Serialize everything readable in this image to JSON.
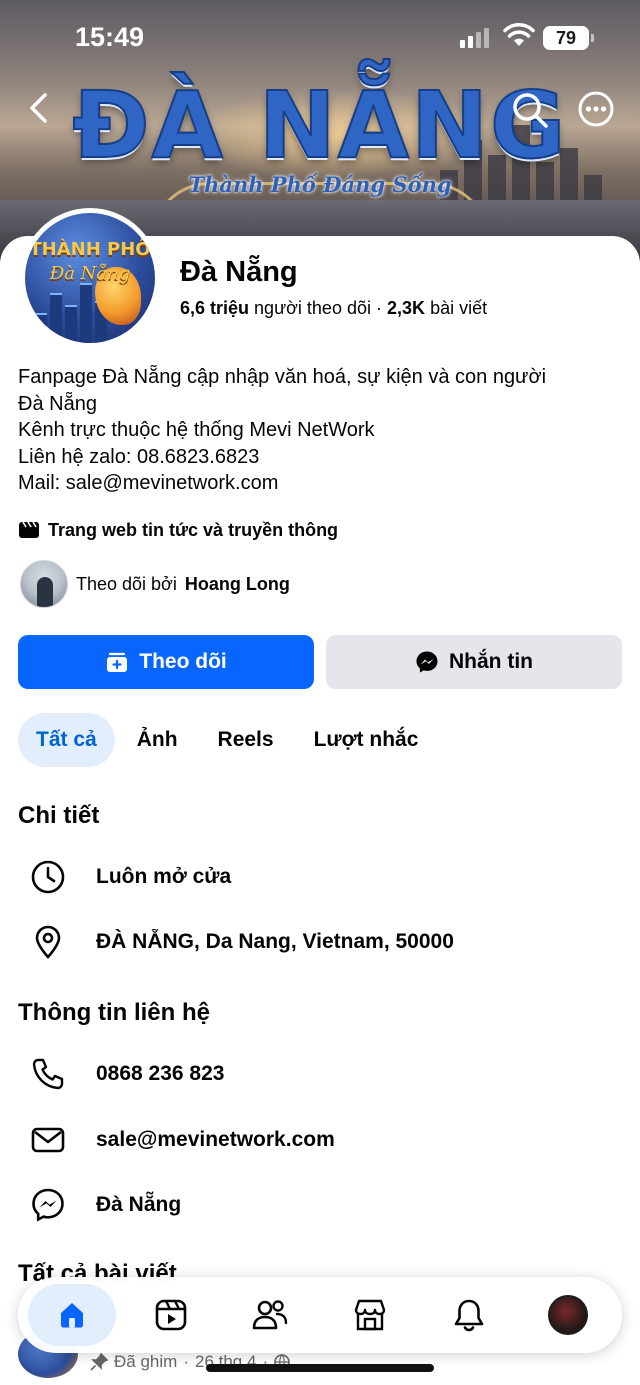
{
  "status_bar": {
    "time": "15:49",
    "battery": "79"
  },
  "cover": {
    "title": "ĐÀ NẴNG",
    "subtitle": "Thành Phố Đáng Sống"
  },
  "avatar": {
    "line1": "THÀNH PHỐ",
    "line2": "Đà Nẵng"
  },
  "page": {
    "name": "Đà Nẵng",
    "followers_count": "6,6 triệu",
    "followers_label": "người theo dõi",
    "separator": "·",
    "posts_count": "2,3K",
    "posts_label": "bài viết"
  },
  "bio": [
    "Fanpage Đà Nẵng cập nhập văn hoá, sự kiện và con người",
    "Đà Nẵng",
    "Kênh trực thuộc hệ thống Mevi NetWork",
    "Liên hệ zalo: 08.6823.6823",
    "Mail: sale@mevinetwork.com"
  ],
  "category": "Trang web tin tức và truyền thông",
  "followed_by": {
    "prefix": "Theo dõi bởi",
    "name": "Hoang Long"
  },
  "buttons": {
    "follow": "Theo dõi",
    "message": "Nhắn tin"
  },
  "tabs": [
    "Tất cả",
    "Ảnh",
    "Reels",
    "Lượt nhắc"
  ],
  "details": {
    "title": "Chi tiết",
    "hours": "Luôn mở cửa",
    "address": "ĐÀ NẴNG, Da Nang, Vietnam, 50000"
  },
  "contact": {
    "title": "Thông tin liên hệ",
    "phone": "0868 236 823",
    "email": "sale@mevinetwork.com",
    "messenger": "Đà Nẵng"
  },
  "posts": {
    "title": "Tất cả bài viết",
    "pinned_label": "Đã ghim",
    "date": "26 thg 4",
    "dot": "·"
  },
  "colors": {
    "accent": "#0866ff",
    "tab_active_bg": "#e2eefc",
    "tab_active_text": "#0064d1",
    "secondary_button": "#e4e6eb"
  },
  "icons": {
    "nav": [
      "home-icon",
      "reels-icon",
      "friends-icon",
      "marketplace-icon",
      "notifications-icon",
      "profile-avatar"
    ]
  }
}
